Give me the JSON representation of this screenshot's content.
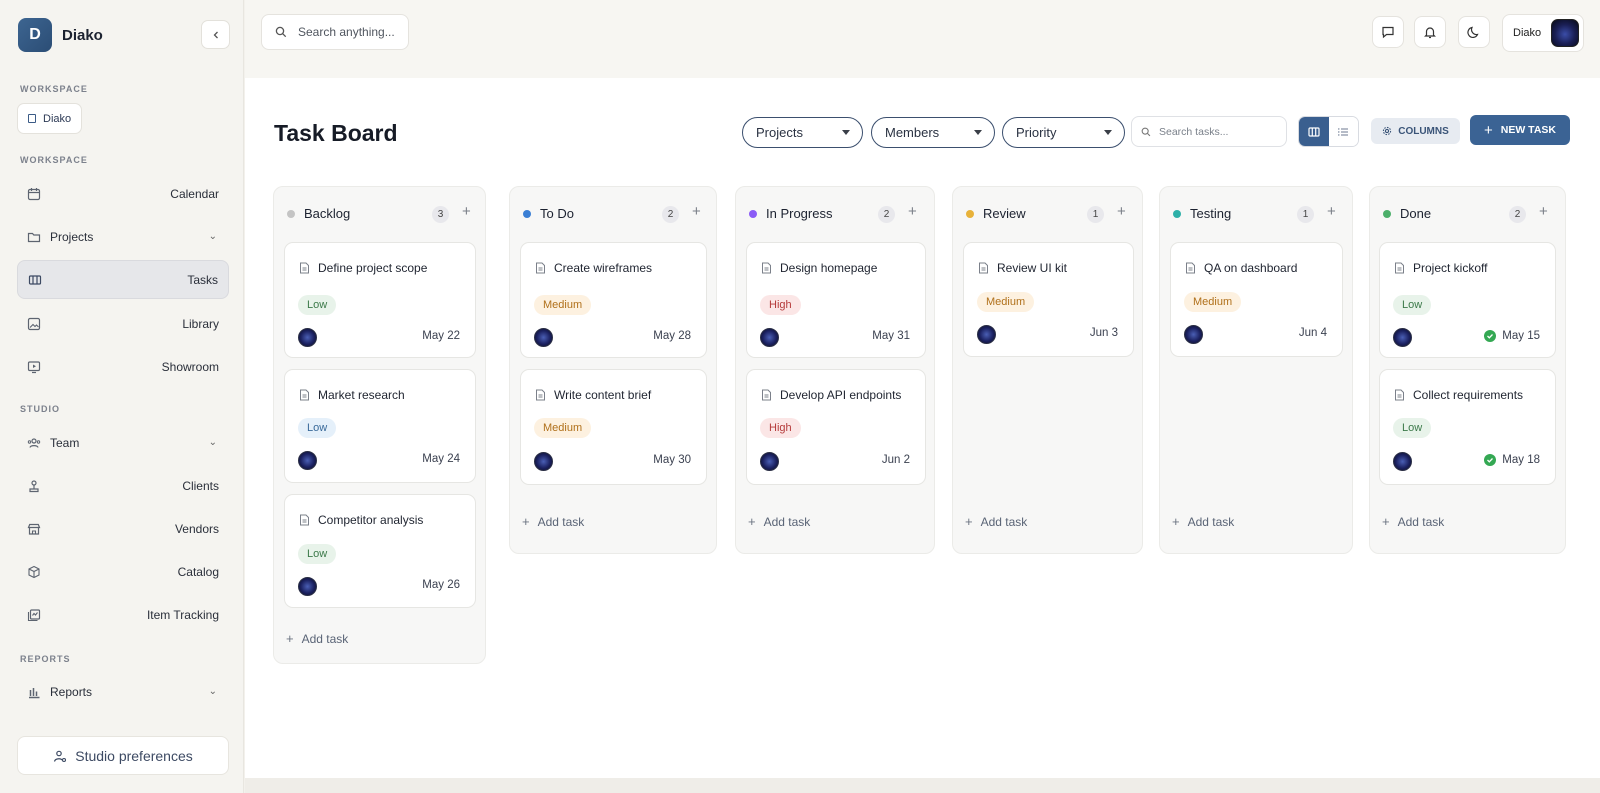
{
  "brand": {
    "initial": "D",
    "name": "Diako"
  },
  "sidebar": {
    "workspace_label": "WORKSPACE",
    "workspace_chip": "Diako",
    "workspace_label_2": "WORKSPACE",
    "studio_label": "STUDIO",
    "reports_label": "REPORTS",
    "items": {
      "calendar": "Calendar",
      "projects": "Projects",
      "tasks": "Tasks",
      "library": "Library",
      "showroom": "Showroom",
      "team": "Team",
      "clients": "Clients",
      "vendors": "Vendors",
      "catalog": "Catalog",
      "item_tracking": "Item Tracking",
      "reports": "Reports"
    },
    "prefs_button": "Studio preferences"
  },
  "topbar": {
    "search_placeholder": "Search anything...",
    "user_name": "Diako"
  },
  "main": {
    "title": "Task Board",
    "filters": {
      "projects": "Projects",
      "members": "Members",
      "priority": "Priority"
    },
    "task_search_placeholder": "Search tasks...",
    "columns_button": "COLUMNS",
    "new_task_button": "NEW TASK",
    "add_task_label": "Add task"
  },
  "board": {
    "backlog": {
      "title": "Backlog",
      "count": "3",
      "color": "#c4c4c4",
      "cards": [
        {
          "title": "Define project scope",
          "priority": "Low",
          "due": "May 22"
        },
        {
          "title": "Market research",
          "priority": "Low",
          "due": "May 24"
        },
        {
          "title": "Competitor analysis",
          "priority": "Low",
          "due": "May 26"
        }
      ]
    },
    "todo": {
      "title": "To Do",
      "count": "2",
      "color": "#3b7fd4",
      "cards": [
        {
          "title": "Create wireframes",
          "priority": "Medium",
          "due": "May 28"
        },
        {
          "title": "Write content brief",
          "priority": "Medium",
          "due": "May 30"
        }
      ]
    },
    "inprogress": {
      "title": "In Progress",
      "count": "2",
      "color": "#8b5cf6",
      "cards": [
        {
          "title": "Design homepage",
          "priority": "High",
          "due": "May 31"
        },
        {
          "title": "Develop API endpoints",
          "priority": "High",
          "due": "Jun 2"
        }
      ]
    },
    "review": {
      "title": "Review",
      "count": "1",
      "color": "#e8b23a",
      "cards": [
        {
          "title": "Review UI kit",
          "priority": "Medium",
          "due": "Jun 3"
        }
      ]
    },
    "testing": {
      "title": "Testing",
      "count": "1",
      "color": "#2eb0a8",
      "cards": [
        {
          "title": "QA on dashboard",
          "priority": "Medium",
          "due": "Jun 4"
        }
      ]
    },
    "done": {
      "title": "Done",
      "count": "2",
      "color": "#4caf6a",
      "cards": [
        {
          "title": "Project kickoff",
          "priority": "Low",
          "due": "May 15"
        },
        {
          "title": "Collect requirements",
          "priority": "Low",
          "due": "May 18"
        }
      ]
    }
  }
}
